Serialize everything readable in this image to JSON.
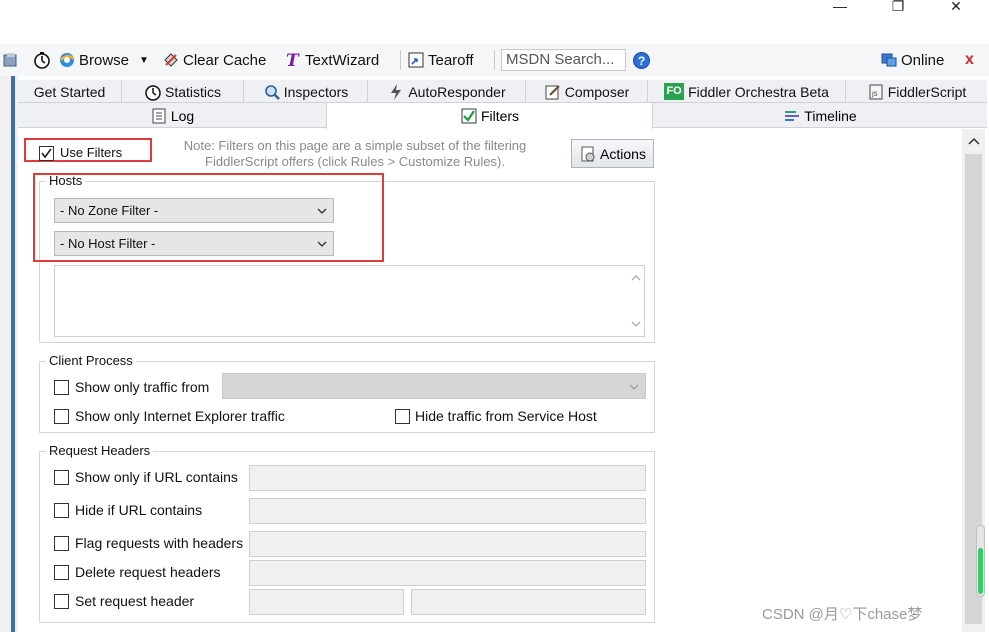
{
  "window_controls": {
    "minimize": "—",
    "restore": "❐",
    "close": "✕"
  },
  "toolbar": {
    "browse": "Browse",
    "clear_cache": "Clear Cache",
    "text_wizard": "TextWizard",
    "tearoff": "Tearoff",
    "search_placeholder": "MSDN Search...",
    "help": "?",
    "online": "Online",
    "close": "x"
  },
  "tabs_row1": [
    {
      "label": "Get Started"
    },
    {
      "label": "Statistics"
    },
    {
      "label": "Inspectors"
    },
    {
      "label": "AutoResponder"
    },
    {
      "label": "Composer"
    },
    {
      "label": "Fiddler Orchestra Beta",
      "badge": "FO"
    },
    {
      "label": "FiddlerScript"
    }
  ],
  "tabs_row2": [
    {
      "label": "Log"
    },
    {
      "label": "Filters"
    },
    {
      "label": "Timeline"
    }
  ],
  "filters": {
    "use_filters_label": "Use Filters",
    "use_filters_checked": true,
    "note": "Note: Filters on this page are a simple subset of the filtering FiddlerScript offers (click Rules > Customize Rules).",
    "note_line1": "Note: Filters on this page are a simple subset of the filtering",
    "note_line2": "FiddlerScript offers (click Rules > Customize Rules).",
    "actions_label": "Actions",
    "hosts": {
      "title": "Hosts",
      "zone_filter": "- No Zone Filter -",
      "host_filter": "- No Host Filter -"
    },
    "client_process": {
      "title": "Client Process",
      "show_only_traffic_from": "Show only traffic from",
      "show_only_ie": "Show only Internet Explorer traffic",
      "hide_service_host": "Hide traffic from Service Host"
    },
    "request_headers": {
      "title": "Request Headers",
      "show_if_url": "Show only if URL contains",
      "hide_if_url": "Hide if URL contains",
      "flag_with_headers": "Flag requests with headers",
      "delete_headers": "Delete request headers",
      "set_header": "Set request header"
    }
  },
  "watermark": "CSDN @月♡下chase梦",
  "colors": {
    "annotation_red": "#e03b3b",
    "scroll_green": "#37c96a",
    "selected_tab_bg": "#ffffff"
  }
}
